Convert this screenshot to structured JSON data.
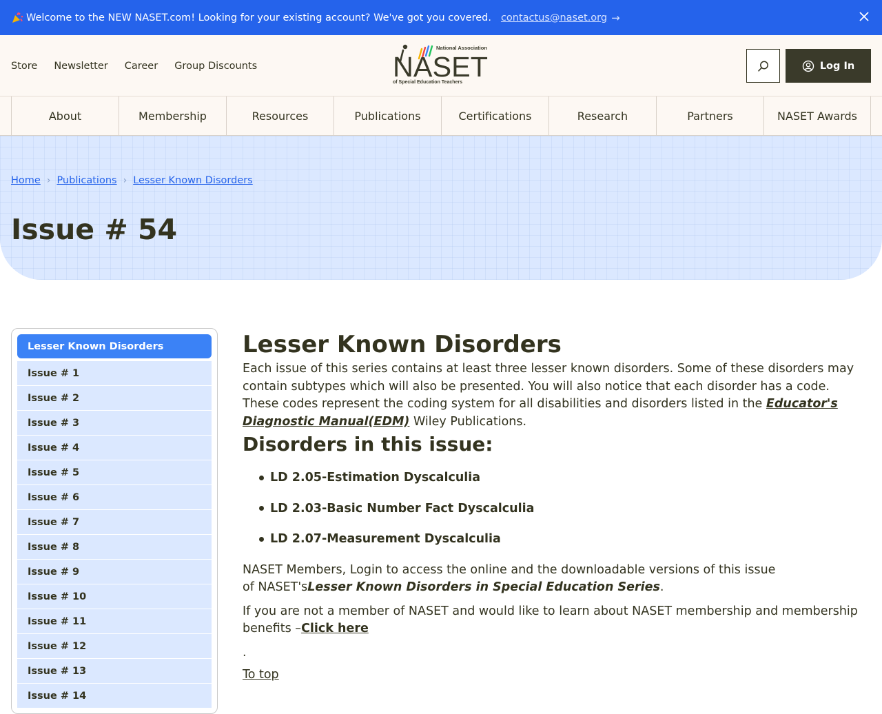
{
  "announcement": {
    "message": "Welcome to the NEW NASET.com! Looking for your existing account? We've got you covered.",
    "email_link": "contactus@naset.org",
    "arrow": "→",
    "icons": [
      "confetti-icon",
      "arrow-right-icon",
      "close-icon"
    ]
  },
  "header": {
    "util_links": [
      "Store",
      "Newsletter",
      "Career",
      "Group Discounts"
    ],
    "logo": {
      "top_text": "National Association",
      "main_text": "NASET",
      "bottom_text": "of Special Education Teachers"
    },
    "login_label": "Log In",
    "icons": [
      "search-icon",
      "user-icon"
    ]
  },
  "nav": {
    "items": [
      "About",
      "Membership",
      "Resources",
      "Publications",
      "Certifications",
      "Research",
      "Partners",
      "NASET Awards"
    ]
  },
  "hero": {
    "breadcrumb": [
      "Home",
      "Publications",
      "Lesser Known Disorders"
    ],
    "title": "Issue # 54"
  },
  "sidebar": {
    "heading": "Lesser Known Disorders",
    "items": [
      "Issue # 1",
      "Issue # 2",
      "Issue # 3",
      "Issue # 4",
      "Issue # 5",
      "Issue # 6",
      "Issue # 7",
      "Issue # 8",
      "Issue # 9",
      "Issue # 10",
      "Issue # 11",
      "Issue # 12",
      "Issue # 13",
      "Issue # 14"
    ]
  },
  "content": {
    "heading": "Lesser Known Disorders",
    "intro_text": "Each issue of this series contains at least three lesser known disorders. Some of these disorders may contain subtypes which will also be presented. You will also notice that each disorder has a code. These codes represent the coding system for all disabilities and disorders listed in the ",
    "intro_link": "Educator's Diagnostic Manual(EDM)",
    "intro_tail": " Wiley Publications.",
    "subheading": "Disorders in this issue:",
    "disorders": [
      "LD 2.05-Estimation Dyscalculia",
      "LD 2.03-Basic Number Fact Dyscalculia",
      "LD 2.07-Measurement Dyscalculia"
    ],
    "members_text": "NASET Members, Login to access the online and the downloadable versions of this issue of NASET's",
    "series_name": "Lesser Known Disorders in Special Education Series",
    "series_tail": ".",
    "nonmember_text": "If you are not a member of NASET and would like to learn about NASET membership and membership benefits –",
    "click_here": "Click here",
    "dot": ".",
    "to_top": "To top"
  },
  "colors": {
    "announce_bg": "#2563eb",
    "header_bg": "#fdf8f3",
    "hero_bg": "#dbe8ff",
    "accent": "#3b82f6",
    "login_bg": "#3a3a2a",
    "text": "#33331f"
  }
}
